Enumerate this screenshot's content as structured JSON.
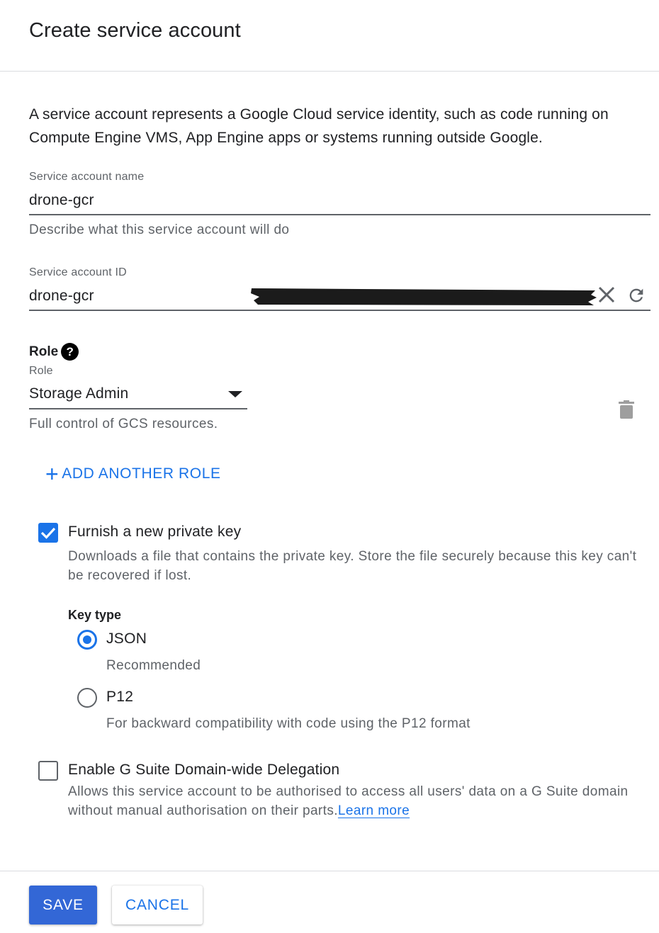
{
  "dialog": {
    "title": "Create service account",
    "intro": "A service account represents a Google Cloud service identity, such as code running on Compute Engine VMS, App Engine apps or systems running outside Google."
  },
  "name_field": {
    "label": "Service account name",
    "value": "drone-gcr",
    "hint": "Describe what this service account will do"
  },
  "id_field": {
    "label": "Service account ID",
    "value": "drone-gcr",
    "clear_icon": "close-icon",
    "refresh_icon": "refresh-icon"
  },
  "role": {
    "heading": "Role",
    "help_icon": "?",
    "select_label": "Role",
    "selected": "Storage Admin",
    "description": "Full control of GCS resources.",
    "delete_icon": "trash-icon",
    "add_plus": "+",
    "add_label": "ADD ANOTHER ROLE"
  },
  "private_key": {
    "checked": true,
    "label": "Furnish a new private key",
    "description": "Downloads a file that contains the private key. Store the file securely because this key can't be recovered if lost.",
    "key_type_label": "Key type",
    "options": [
      {
        "label": "JSON",
        "sub": "Recommended",
        "selected": true
      },
      {
        "label": "P12",
        "sub": "For backward compatibility with code using the P12 format",
        "selected": false
      }
    ]
  },
  "delegation": {
    "checked": false,
    "label": "Enable G Suite Domain-wide Delegation",
    "description": "Allows this service account to be authorised to access all users' data on a G Suite domain without manual authorisation on their parts.",
    "learn_more": "Learn more"
  },
  "actions": {
    "save": "SAVE",
    "cancel": "CANCEL"
  },
  "colors": {
    "accent": "#1a73e8",
    "save_button": "#3367d6",
    "secondary_text": "#5f6368"
  }
}
